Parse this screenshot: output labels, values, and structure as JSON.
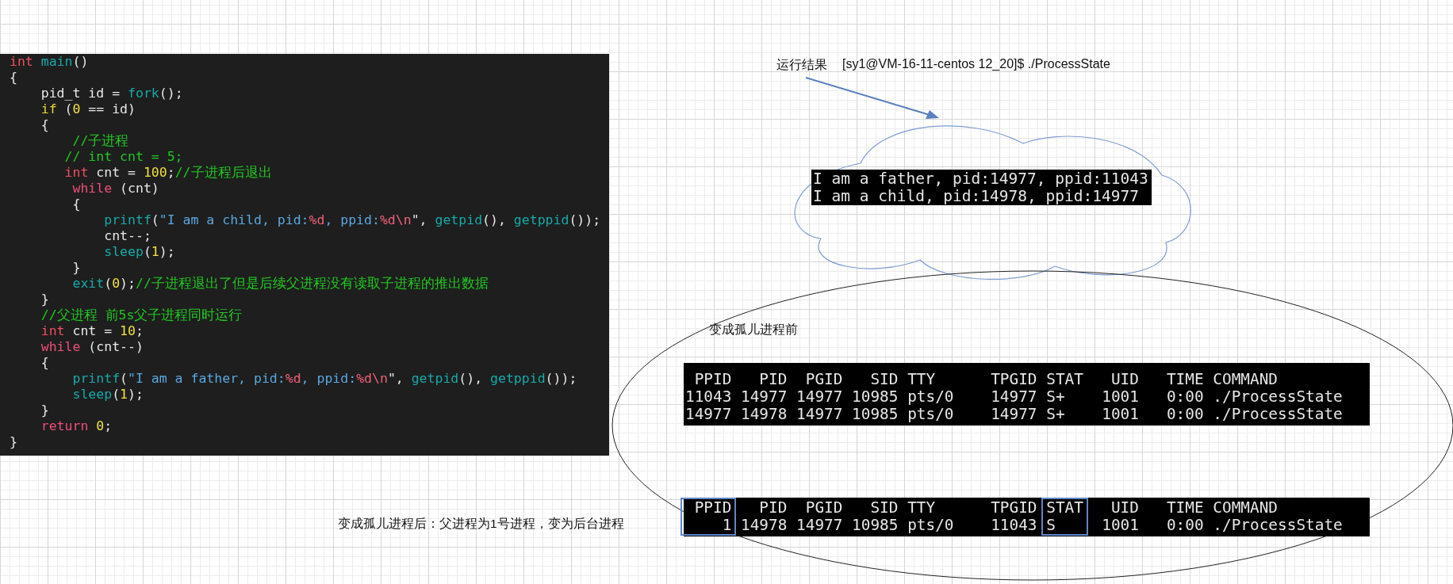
{
  "code_panel": {
    "lines": [
      [
        {
          "text": "int",
          "kind": "type"
        },
        {
          "text": " main",
          "kind": "func"
        },
        {
          "text": "()",
          "kind": "plain"
        }
      ],
      [
        {
          "text": "{",
          "kind": "plain"
        }
      ],
      [
        {
          "text": "    pid_t id = ",
          "kind": "plain"
        },
        {
          "text": "fork",
          "kind": "func"
        },
        {
          "text": "();",
          "kind": "plain"
        }
      ],
      [
        {
          "text": "    if",
          "kind": "cond"
        },
        {
          "text": " (",
          "kind": "plain"
        },
        {
          "text": "0",
          "kind": "number"
        },
        {
          "text": " == id)",
          "kind": "plain"
        }
      ],
      [
        {
          "text": "    {",
          "kind": "plain"
        }
      ],
      [
        {
          "text": "        //子进程",
          "kind": "comment"
        }
      ],
      [
        {
          "text": "       // int cnt = 5;",
          "kind": "comment"
        }
      ],
      [
        {
          "text": "       int",
          "kind": "type"
        },
        {
          "text": " cnt = ",
          "kind": "plain"
        },
        {
          "text": "100",
          "kind": "number"
        },
        {
          "text": ";",
          "kind": "plain"
        },
        {
          "text": "//子进程后退出",
          "kind": "comment"
        }
      ],
      [
        {
          "text": "        while",
          "kind": "keyword"
        },
        {
          "text": " (cnt)",
          "kind": "plain"
        }
      ],
      [
        {
          "text": "        {",
          "kind": "plain"
        }
      ],
      [
        {
          "text": "            printf",
          "kind": "func"
        },
        {
          "text": "(",
          "kind": "plain"
        },
        {
          "text": "\"I am a child, pid:",
          "kind": "string"
        },
        {
          "text": "%d",
          "kind": "format"
        },
        {
          "text": ", ppid:",
          "kind": "string"
        },
        {
          "text": "%d\\n",
          "kind": "format"
        },
        {
          "text": "\", ",
          "kind": "plain"
        },
        {
          "text": "getpid",
          "kind": "func"
        },
        {
          "text": "(), ",
          "kind": "plain"
        },
        {
          "text": "getppid",
          "kind": "func"
        },
        {
          "text": "());",
          "kind": "plain"
        }
      ],
      [
        {
          "text": "            cnt--;",
          "kind": "plain"
        }
      ],
      [
        {
          "text": "            sleep",
          "kind": "func"
        },
        {
          "text": "(",
          "kind": "plain"
        },
        {
          "text": "1",
          "kind": "number"
        },
        {
          "text": ");",
          "kind": "plain"
        }
      ],
      [
        {
          "text": "        }",
          "kind": "plain"
        }
      ],
      [
        {
          "text": "        exit",
          "kind": "func"
        },
        {
          "text": "(",
          "kind": "plain"
        },
        {
          "text": "0",
          "kind": "number"
        },
        {
          "text": ");",
          "kind": "plain"
        },
        {
          "text": "//子进程退出了但是后续父进程没有读取子进程的推出数据",
          "kind": "comment"
        }
      ],
      [
        {
          "text": "    }",
          "kind": "plain"
        }
      ],
      [
        {
          "text": "    //父进程 前5s父子进程同时运行",
          "kind": "comment"
        }
      ],
      [
        {
          "text": "    int",
          "kind": "type"
        },
        {
          "text": " cnt = ",
          "kind": "plain"
        },
        {
          "text": "10",
          "kind": "number"
        },
        {
          "text": ";",
          "kind": "plain"
        }
      ],
      [
        {
          "text": "    while",
          "kind": "keyword"
        },
        {
          "text": " (cnt--)",
          "kind": "plain"
        }
      ],
      [
        {
          "text": "    {",
          "kind": "plain"
        }
      ],
      [
        {
          "text": "        printf",
          "kind": "func"
        },
        {
          "text": "(",
          "kind": "plain"
        },
        {
          "text": "\"I am a father, pid:",
          "kind": "string"
        },
        {
          "text": "%d",
          "kind": "format"
        },
        {
          "text": ", ppid:",
          "kind": "string"
        },
        {
          "text": "%d\\n",
          "kind": "format"
        },
        {
          "text": "\", ",
          "kind": "plain"
        },
        {
          "text": "getpid",
          "kind": "func"
        },
        {
          "text": "(), ",
          "kind": "plain"
        },
        {
          "text": "getppid",
          "kind": "func"
        },
        {
          "text": "());",
          "kind": "plain"
        }
      ],
      [
        {
          "text": "        sleep",
          "kind": "func"
        },
        {
          "text": "(",
          "kind": "plain"
        },
        {
          "text": "1",
          "kind": "number"
        },
        {
          "text": ");",
          "kind": "plain"
        }
      ],
      [
        {
          "text": "    }",
          "kind": "plain"
        }
      ],
      [
        {
          "text": "    return",
          "kind": "keyword"
        },
        {
          "text": " 0",
          "kind": "number"
        },
        {
          "text": ";",
          "kind": "plain"
        }
      ],
      [
        {
          "text": "}",
          "kind": "plain"
        }
      ]
    ]
  },
  "result_label": "运行结果",
  "command_prompt": "[sy1@VM-16-11-centos 12_20]$ ./ProcessState",
  "cloud_output": {
    "lines": [
      "I am a father, pid:14977, ppid:11043",
      "I am a child, pid:14978, ppid:14977"
    ]
  },
  "before_label": "变成孤儿进程前",
  "terminal_before": {
    "columns": [
      {
        "header": "PPID",
        "values": [
          "11043",
          "14977"
        ]
      },
      {
        "header": "PID",
        "values": [
          "14977",
          "14978"
        ]
      },
      {
        "header": "PGID",
        "values": [
          "14977",
          "14977"
        ]
      },
      {
        "header": "SID",
        "values": [
          "10985",
          "10985"
        ]
      },
      {
        "header": "TTY",
        "values": [
          "pts/0",
          "pts/0"
        ]
      },
      {
        "header": "TPGID",
        "values": [
          "14977",
          "14977"
        ]
      },
      {
        "header": "STAT",
        "values": [
          "S+",
          "S+"
        ]
      },
      {
        "header": "UID",
        "values": [
          "1001",
          "1001"
        ]
      },
      {
        "header": "TIME",
        "values": [
          "0:00",
          "0:00"
        ]
      },
      {
        "header": "COMMAND",
        "values": [
          "./ProcessState",
          "./ProcessState"
        ]
      }
    ]
  },
  "after_label": "变成孤儿进程后：父进程为1号进程，变为后台进程",
  "terminal_after": {
    "columns": [
      {
        "header": "PPID",
        "values": [
          "1"
        ],
        "highlighted": true
      },
      {
        "header": "PID",
        "values": [
          "14978"
        ],
        "highlighted": false
      },
      {
        "header": "PGID",
        "values": [
          "14977"
        ],
        "highlighted": false
      },
      {
        "header": "SID",
        "values": [
          "10985"
        ],
        "highlighted": false
      },
      {
        "header": "TTY",
        "values": [
          "pts/0"
        ],
        "highlighted": false
      },
      {
        "header": "TPGID",
        "values": [
          "11043"
        ],
        "highlighted": false
      },
      {
        "header": "STAT",
        "values": [
          "S"
        ],
        "highlighted": true
      },
      {
        "header": "UID",
        "values": [
          "1001"
        ],
        "highlighted": false
      },
      {
        "header": "TIME",
        "values": [
          "0:00"
        ],
        "highlighted": false
      },
      {
        "header": "COMMAND",
        "values": [
          "./ProcessState"
        ],
        "highlighted": false
      }
    ]
  }
}
